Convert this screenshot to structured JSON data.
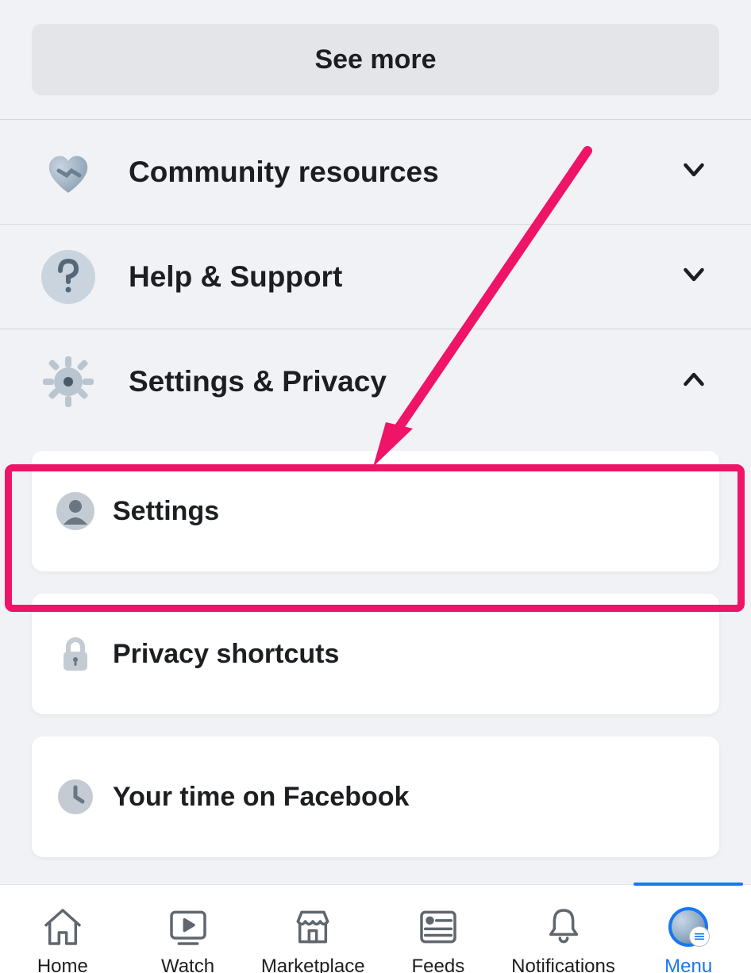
{
  "see_more_label": "See more",
  "sections": {
    "community": {
      "label": "Community resources",
      "expanded": false
    },
    "help": {
      "label": "Help & Support",
      "expanded": false
    },
    "settings": {
      "label": "Settings & Privacy",
      "expanded": true
    }
  },
  "settings_items": {
    "settings": {
      "label": "Settings"
    },
    "privacy_shortcuts": {
      "label": "Privacy shortcuts"
    },
    "your_time": {
      "label": "Your time on Facebook"
    }
  },
  "nav": {
    "home": {
      "label": "Home"
    },
    "watch": {
      "label": "Watch"
    },
    "marketplace": {
      "label": "Marketplace"
    },
    "feeds": {
      "label": "Feeds"
    },
    "notifications": {
      "label": "Notifications"
    },
    "menu": {
      "label": "Menu",
      "active": true
    }
  },
  "annotation": {
    "highlight_target": "settings-item"
  }
}
